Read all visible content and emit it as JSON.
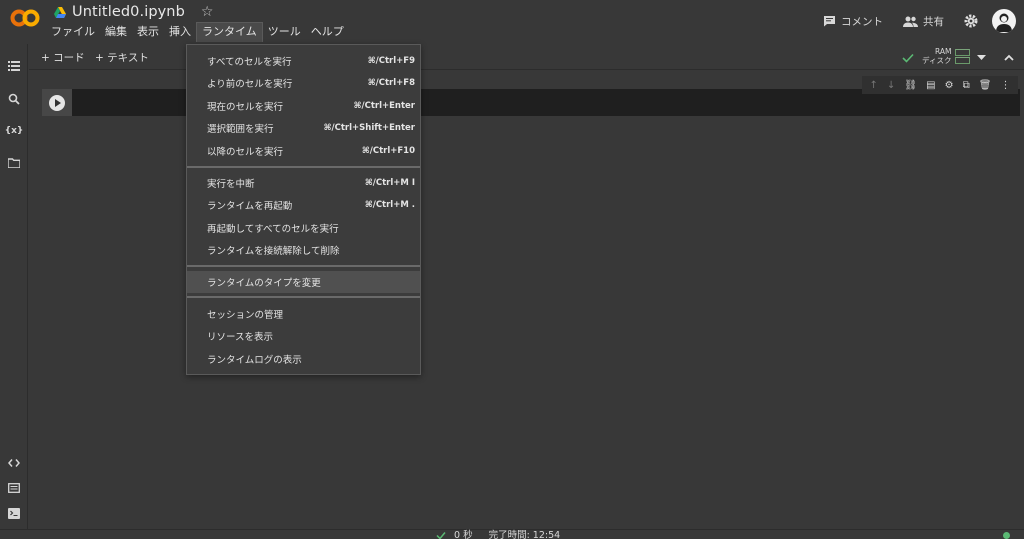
{
  "header": {
    "notebook_title": "Untitled0.ipynb",
    "menu": [
      "ファイル",
      "編集",
      "表示",
      "挿入",
      "ランタイム",
      "ツール",
      "ヘルプ"
    ],
    "comment_label": "コメント",
    "share_label": "共有"
  },
  "toolbar": {
    "add_code": "+ コード",
    "add_text": "+ テキスト",
    "ram_label": "RAM",
    "disk_label": "ディスク"
  },
  "runtime_menu": {
    "items": [
      {
        "label": "すべてのセルを実行",
        "shortcut": "⌘/Ctrl+F9"
      },
      {
        "label": "より前のセルを実行",
        "shortcut": "⌘/Ctrl+F8"
      },
      {
        "label": "現在のセルを実行",
        "shortcut": "⌘/Ctrl+Enter"
      },
      {
        "label": "選択範囲を実行",
        "shortcut": "⌘/Ctrl+Shift+Enter"
      },
      {
        "label": "以降のセルを実行",
        "shortcut": "⌘/Ctrl+F10"
      },
      {
        "label": "実行を中断",
        "shortcut": "⌘/Ctrl+M I"
      },
      {
        "label": "ランタイムを再起動",
        "shortcut": "⌘/Ctrl+M ."
      },
      {
        "label": "再起動してすべてのセルを実行",
        "shortcut": ""
      },
      {
        "label": "ランタイムを接続解除して削除",
        "shortcut": ""
      },
      {
        "label": "ランタイムのタイプを変更",
        "shortcut": ""
      },
      {
        "label": "セッションの管理",
        "shortcut": ""
      },
      {
        "label": "リソースを表示",
        "shortcut": ""
      },
      {
        "label": "ランタイムログの表示",
        "shortcut": ""
      }
    ],
    "highlighted_index": 9
  },
  "status": {
    "elapsed": "0 秒",
    "completed": "完了時間: 12:54"
  },
  "colors": {
    "background": "#383838",
    "menu_bg": "#3c3c3c",
    "logo_orange": "#F9AB00",
    "logo_dark_orange": "#E8710A",
    "check_green": "#5bb974"
  }
}
